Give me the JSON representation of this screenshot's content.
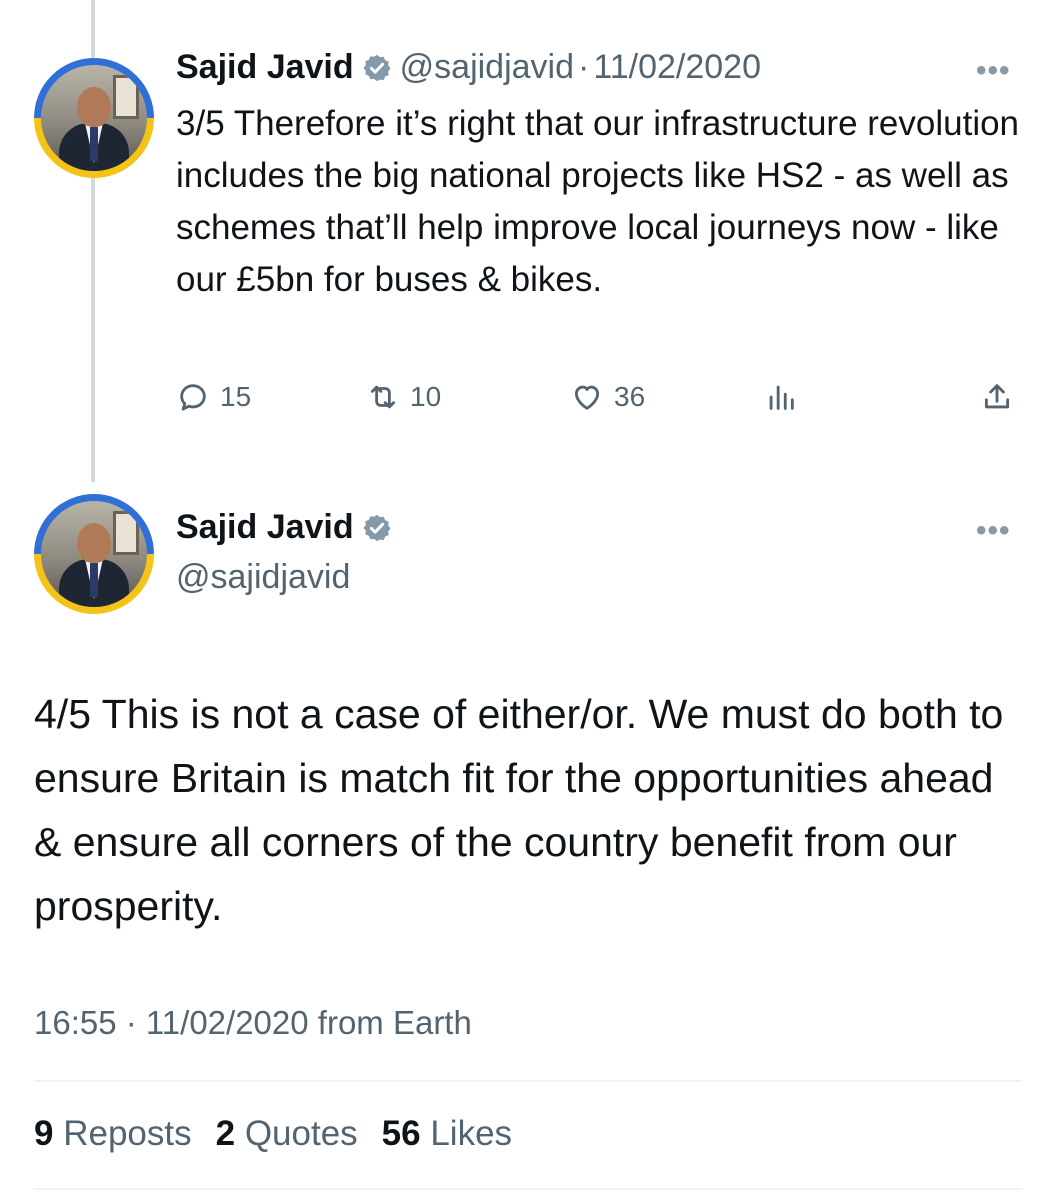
{
  "thread_reply": {
    "author": {
      "name": "Sajid Javid",
      "handle": "@sajidjavid",
      "separator": "·",
      "date": "11/02/2020",
      "verified_icon": "verified-badge-icon"
    },
    "text": "3/5 Therefore it’s right that our infrastructure revolution includes the big national projects like HS2 - as well as schemes that’ll help improve local journeys now - like our £5bn for buses & bikes.",
    "more_label": "•••",
    "actions": {
      "replies": "15",
      "reposts": "10",
      "likes": "36"
    }
  },
  "main_tweet": {
    "author": {
      "name": "Sajid Javid",
      "handle": "@sajidjavid",
      "verified_icon": "verified-badge-icon"
    },
    "more_label": "•••",
    "text": "4/5 This is not a case of either/or. We must do both to ensure Britain is match fit for the opportunities ahead & ensure all corners of the country benefit from our prosperity.",
    "timestamp": "16:55 · 11/02/2020 from Earth",
    "stats": {
      "reposts_count": "9",
      "reposts_label": "Reposts",
      "quotes_count": "2",
      "quotes_label": "Quotes",
      "likes_count": "56",
      "likes_label": "Likes"
    }
  },
  "colors": {
    "text_primary": "#0f1419",
    "text_secondary": "#536471",
    "verified_badge": "#829aab",
    "thread_line": "#cfd9de",
    "avatar_ring_blue": "#2f6fd6",
    "avatar_ring_yellow": "#f3c417"
  }
}
